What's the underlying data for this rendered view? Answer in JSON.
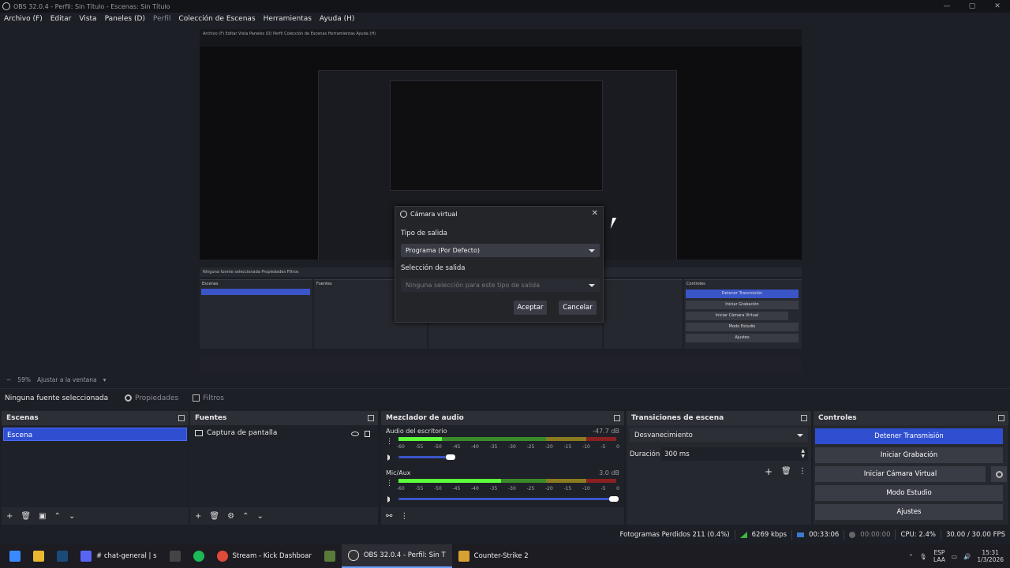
{
  "window": {
    "title": "OBS 32.0.4 - Perfil: Sin Título - Escenas: Sin Título",
    "minimize": "—",
    "maximize": "▢",
    "close": "✕"
  },
  "menu": [
    "Archivo (F)",
    "Editar",
    "Vista",
    "Paneles (D)",
    "Perfil",
    "Colección de Escenas",
    "Herramientas",
    "Ayuda (H)"
  ],
  "preview": {
    "nested_menu": "Archivo (F)  Editar  Vista  Paneles (D)  Perfil  Colección de Escenas  Herramientas  Ayuda (H)",
    "panel_bar": "Ninguna fuente seleccionada   Propiedades   Filtros",
    "scenes": "Escenas",
    "scene_item": "Escena",
    "sources": "Fuentes",
    "source_item": "Captura de pantalla",
    "transitions": "Transiciones de escena",
    "controls": "Controles",
    "ctl_stop": "Detener Transmisión",
    "ctl_rec": "Iniciar Grabación",
    "ctl_vcam": "Iniciar Cámara Virtual",
    "ctl_studio": "Modo Estudio",
    "ctl_settings": "Ajustes",
    "status": "Fotogramas Perdidos 211 (0.4%)  6269 kbps   00:33:06   00:00:00  CPU: 2.4%  30.00 / 30.00 FPS",
    "zoom": "59%   Ajustar a la ventana"
  },
  "vcam_dialog": {
    "title": "Cámara virtual",
    "close": "✕",
    "output_type_label": "Tipo de salida",
    "output_type_value": "Programa (Por Defecto)",
    "output_sel_label": "Selección de salida",
    "output_sel_placeholder": "Ninguna selección para este tipo de salida",
    "accept": "Aceptar",
    "cancel": "Cancelar"
  },
  "zoom_bar": {
    "minus": "−",
    "percent": "59%",
    "fit": "Ajustar a la ventana"
  },
  "context_bar": {
    "no_source": "Ninguna fuente seleccionada",
    "properties": "Propiedades",
    "filters": "Filtros"
  },
  "scenes_dock": {
    "title": "Escenas",
    "items": [
      "Escena"
    ]
  },
  "sources_dock": {
    "title": "Fuentes",
    "items": [
      "Captura de pantalla"
    ]
  },
  "mixer_dock": {
    "title": "Mezclador de audio",
    "channels": [
      {
        "name": "Audio del escritorio",
        "db": "-47.7 dB",
        "level": 0.2,
        "volume": 0.25
      },
      {
        "name": "Mic/Aux",
        "db": "3.0 dB",
        "level": 0.47,
        "volume": 1.0
      }
    ],
    "ticks": [
      "-60",
      "-55",
      "-50",
      "-45",
      "-40",
      "-35",
      "-30",
      "-25",
      "-20",
      "-15",
      "-10",
      "-5",
      "0"
    ]
  },
  "transitions_dock": {
    "title": "Transiciones de escena",
    "selected": "Desvanecimiento",
    "duration_label": "Duración",
    "duration_value": "300 ms"
  },
  "controls_dock": {
    "title": "Controles",
    "stop_stream": "Detener Transmisión",
    "start_recording": "Iniciar Grabación",
    "start_vcam": "Iniciar Cámara Virtual",
    "studio_mode": "Modo Estudio",
    "settings": "Ajustes"
  },
  "status_bar": {
    "dropped": "Fotogramas Perdidos 211 (0.4%)",
    "bitrate": "6269 kbps",
    "stream_time": "00:33:06",
    "rec_time": "00:00:00",
    "cpu": "CPU: 2.4%",
    "fps": "30.00 / 30.00 FPS"
  },
  "taskbar": {
    "apps": [
      {
        "label": "# chat-general | s"
      },
      {
        "label": "Stream - Kick Dashboar"
      },
      {
        "label": "OBS 32.0.4 - Perfil: Sin T"
      },
      {
        "label": "Counter-Strike 2"
      }
    ],
    "lang_top": "ESP",
    "lang_bottom": "LAA",
    "time": "15:31",
    "date": "1/3/2026"
  },
  "colors": {
    "accent": "#2f4fd0",
    "background": "#1d1f26",
    "panel": "#26282f"
  }
}
